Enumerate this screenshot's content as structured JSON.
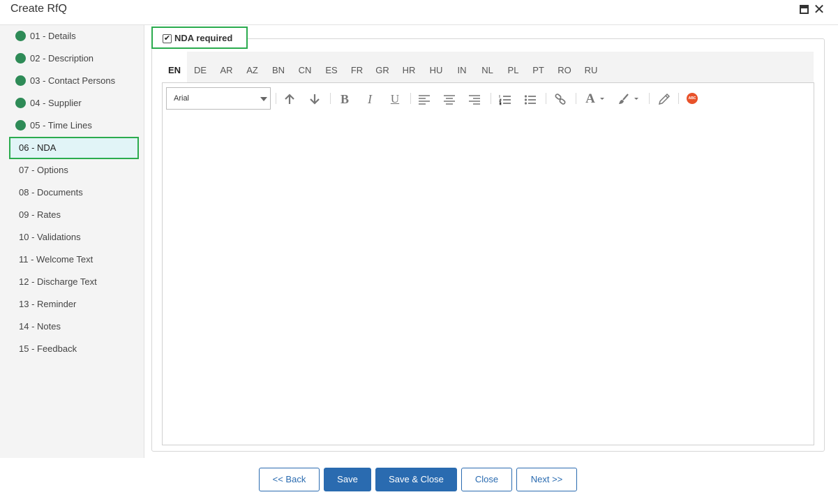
{
  "window": {
    "title": "Create RfQ",
    "maximize_icon": "window-maximize-icon",
    "close_icon": "close-icon"
  },
  "sidebar": {
    "steps": [
      {
        "label": "01 - Details",
        "status": "done"
      },
      {
        "label": "02 - Description",
        "status": "done"
      },
      {
        "label": "03 - Contact Persons",
        "status": "done"
      },
      {
        "label": "04 - Supplier",
        "status": "done"
      },
      {
        "label": "05 - Time Lines",
        "status": "done"
      },
      {
        "label": "06 - NDA",
        "status": "active"
      },
      {
        "label": "07 - Options",
        "status": "todo"
      },
      {
        "label": "08 - Documents",
        "status": "todo"
      },
      {
        "label": "09 - Rates",
        "status": "todo"
      },
      {
        "label": "10 - Validations",
        "status": "todo"
      },
      {
        "label": "11 - Welcome Text",
        "status": "todo"
      },
      {
        "label": "12 - Discharge Text",
        "status": "todo"
      },
      {
        "label": "13 - Reminder",
        "status": "todo"
      },
      {
        "label": "14 - Notes",
        "status": "todo"
      },
      {
        "label": "15 - Feedback",
        "status": "todo"
      }
    ],
    "done_color": "#2e8b57"
  },
  "nda": {
    "checkbox_label": "NDA required",
    "checked": true,
    "check_mark": "✔"
  },
  "languages": {
    "tabs": [
      "EN",
      "DE",
      "AR",
      "AZ",
      "BN",
      "CN",
      "ES",
      "FR",
      "GR",
      "HR",
      "HU",
      "IN",
      "NL",
      "PL",
      "PT",
      "RO",
      "RU"
    ],
    "active": "EN"
  },
  "editor": {
    "font_value": "Arial",
    "toolbar_icons": [
      "arrow-up-icon",
      "arrow-down-icon",
      "bold-icon",
      "italic-icon",
      "underline-icon",
      "align-left-icon",
      "align-center-icon",
      "align-right-icon",
      "ordered-list-icon",
      "unordered-list-icon",
      "link-icon",
      "font-color-icon",
      "highlight-brush-icon",
      "eraser-icon",
      "spellcheck-icon"
    ],
    "bold_glyph": "B",
    "italic_glyph": "I",
    "underline_glyph": "U",
    "font_color_glyph": "A",
    "spellcheck_glyph": "ABC",
    "content": ""
  },
  "footer": {
    "back": "<< Back",
    "save": "Save",
    "save_close": "Save & Close",
    "close": "Close",
    "next": "Next >>"
  },
  "colors": {
    "accent": "#2a6bb0",
    "highlight_border": "#2bab4e",
    "active_step_bg": "#e1f4f7"
  }
}
